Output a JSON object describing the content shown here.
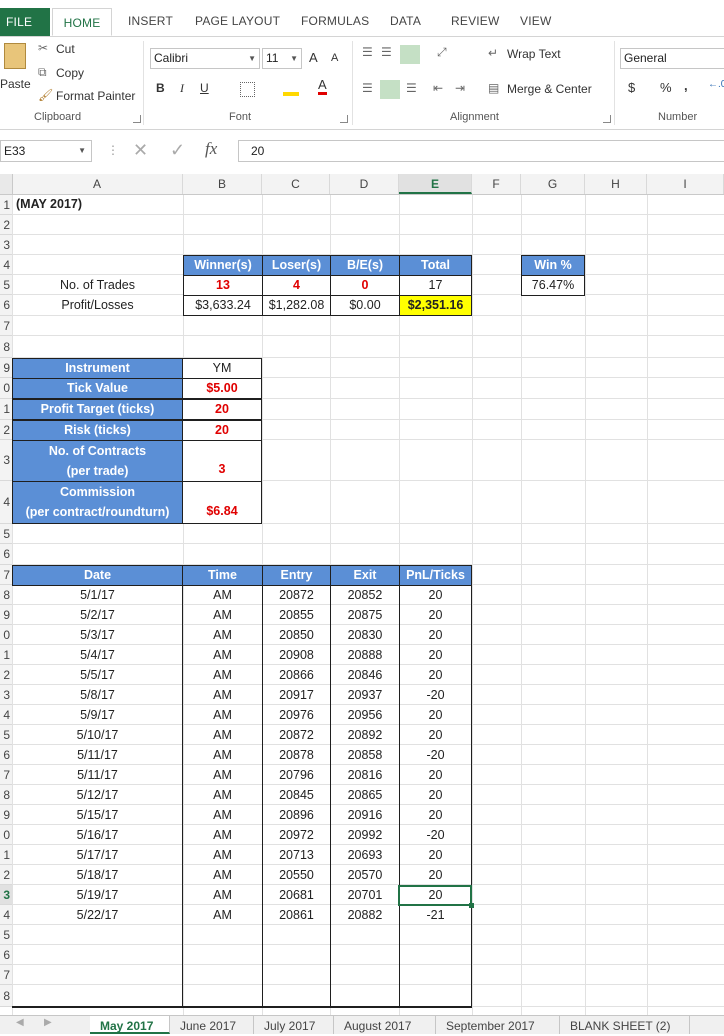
{
  "ribbon_tabs": [
    "FILE",
    "HOME",
    "INSERT",
    "PAGE LAYOUT",
    "FORMULAS",
    "DATA",
    "REVIEW",
    "VIEW"
  ],
  "clipboard": {
    "paste": "Paste",
    "cut": "Cut",
    "copy": "Copy",
    "format_painter": "Format Painter",
    "label": "Clipboard"
  },
  "font": {
    "name": "Calibri",
    "size": "11",
    "bold": "B",
    "italic": "I",
    "underline": "U",
    "label": "Font",
    "grow": "A",
    "shrink": "A",
    "color_a": "A"
  },
  "alignment": {
    "wrap": "Wrap Text",
    "merge": "Merge & Center",
    "label": "Alignment"
  },
  "number": {
    "format": "General",
    "currency": "$",
    "percent": "%",
    "comma": ",",
    "label": "Number"
  },
  "formula_bar": {
    "namebox": "E33",
    "fx": "fx",
    "value": "20"
  },
  "columns": [
    "A",
    "B",
    "C",
    "D",
    "E",
    "F",
    "G",
    "H",
    "I"
  ],
  "selected_column": "E",
  "row_numbers": [
    "1",
    "2",
    "3",
    "4",
    "5",
    "6",
    "7",
    "8",
    "9",
    "0",
    "1",
    "2",
    "3",
    "4",
    "5",
    "6",
    "7",
    "8",
    "9",
    "0",
    "1",
    "2",
    "3",
    "4",
    "5",
    "6",
    "7",
    "8",
    "9",
    "0",
    "1",
    "2",
    "3",
    "4",
    "5",
    "6",
    "7",
    "8"
  ],
  "selected_row_index": 32,
  "title": "(MAY 2017)",
  "summary": {
    "headers": [
      "Winner(s)",
      "Loser(s)",
      "B/E(s)",
      "Total"
    ],
    "trades_label": "No. of Trades",
    "trades": [
      "13",
      "4",
      "0",
      "17"
    ],
    "pnl_label": "Profit/Losses",
    "pnl": [
      "$3,633.24",
      "$1,282.08",
      "$0.00",
      "$2,351.16"
    ],
    "win_label": "Win %",
    "win_value": "76.47%"
  },
  "settings": {
    "instrument_label": "Instrument",
    "instrument": "YM",
    "tick_label": "Tick Value",
    "tick": "$5.00",
    "target_label": "Profit Target (ticks)",
    "target": "20",
    "risk_label": "Risk (ticks)",
    "risk": "20",
    "contracts_label1": "No. of Contracts",
    "contracts_label2": "(per trade)",
    "contracts": "3",
    "commission_label1": "Commission",
    "commission_label2": "(per contract/roundturn)",
    "commission": "$6.84"
  },
  "trades_table": {
    "headers": [
      "Date",
      "Time",
      "Entry",
      "Exit",
      "PnL/Ticks"
    ],
    "rows": [
      [
        "5/1/17",
        "AM",
        "20872",
        "20852",
        "20"
      ],
      [
        "5/2/17",
        "AM",
        "20855",
        "20875",
        "20"
      ],
      [
        "5/3/17",
        "AM",
        "20850",
        "20830",
        "20"
      ],
      [
        "5/4/17",
        "AM",
        "20908",
        "20888",
        "20"
      ],
      [
        "5/5/17",
        "AM",
        "20866",
        "20846",
        "20"
      ],
      [
        "5/8/17",
        "AM",
        "20917",
        "20937",
        "-20"
      ],
      [
        "5/9/17",
        "AM",
        "20976",
        "20956",
        "20"
      ],
      [
        "5/10/17",
        "AM",
        "20872",
        "20892",
        "20"
      ],
      [
        "5/11/17",
        "AM",
        "20878",
        "20858",
        "-20"
      ],
      [
        "5/11/17",
        "AM",
        "20796",
        "20816",
        "20"
      ],
      [
        "5/12/17",
        "AM",
        "20845",
        "20865",
        "20"
      ],
      [
        "5/15/17",
        "AM",
        "20896",
        "20916",
        "20"
      ],
      [
        "5/16/17",
        "AM",
        "20972",
        "20992",
        "-20"
      ],
      [
        "5/17/17",
        "AM",
        "20713",
        "20693",
        "20"
      ],
      [
        "5/18/17",
        "AM",
        "20550",
        "20570",
        "20"
      ],
      [
        "5/19/17",
        "AM",
        "20681",
        "20701",
        "20"
      ],
      [
        "5/22/17",
        "AM",
        "20861",
        "20882",
        "-21"
      ]
    ]
  },
  "sheet_tabs": [
    "May 2017",
    "June 2017",
    "July 2017",
    "August 2017",
    "September 2017",
    "BLANK SHEET (2)"
  ],
  "active_sheet": "May 2017"
}
